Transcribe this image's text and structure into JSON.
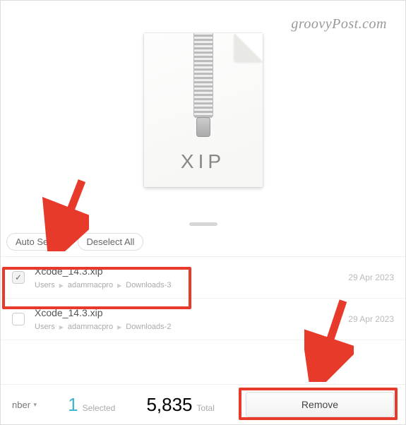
{
  "watermark": "groovyPost.com",
  "preview": {
    "file_type_label": "XIP"
  },
  "actions": {
    "auto_select": "Auto Select",
    "deselect_all": "Deselect All"
  },
  "files": [
    {
      "checked": true,
      "name": "Xcode_14.3.xip",
      "path": [
        "Users",
        "adammacpro",
        "Downloads-3"
      ],
      "date": "29 Apr 2023"
    },
    {
      "checked": false,
      "name": "Xcode_14.3.xip",
      "path": [
        "Users",
        "adammacpro",
        "Downloads-2"
      ],
      "date": "29 Apr 2023"
    }
  ],
  "bottom": {
    "sort_fragment": "nber",
    "selected_count": "1",
    "selected_label": "Selected",
    "total_count": "5,835",
    "total_label": "Total",
    "remove": "Remove"
  }
}
